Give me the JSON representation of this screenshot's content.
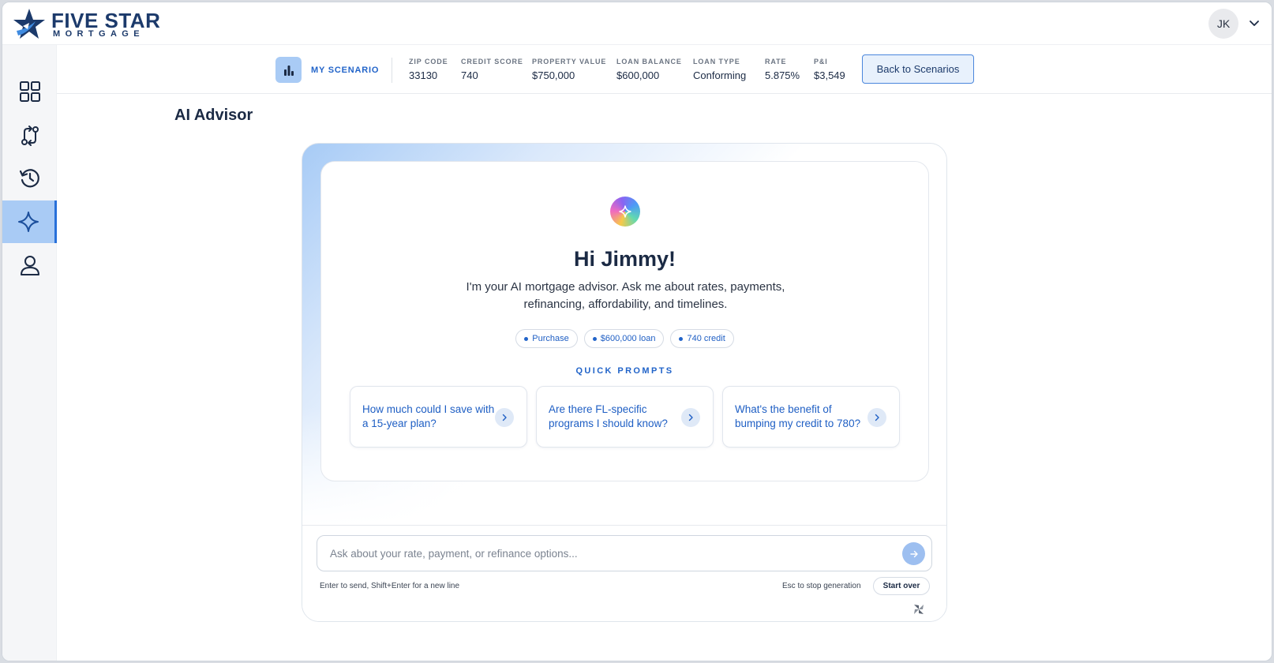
{
  "brand": {
    "name_line1": "FIVE STAR",
    "name_line2": "MORTGAGE",
    "navy": "#1c3a6b",
    "accent": "#2264c9"
  },
  "user": {
    "initials": "JK"
  },
  "sidebar": {
    "items": [
      {
        "name": "dashboard",
        "icon": "grid-icon",
        "active": false
      },
      {
        "name": "compare",
        "icon": "compare-arrows-icon",
        "active": false
      },
      {
        "name": "history",
        "icon": "history-icon",
        "active": false
      },
      {
        "name": "ai-advisor",
        "icon": "sparkle-icon",
        "active": true
      },
      {
        "name": "profile",
        "icon": "user-icon",
        "active": false
      }
    ]
  },
  "scenario": {
    "label": "MY SCENARIO",
    "icon": "bar-chart-icon",
    "stats": [
      {
        "label": "ZIP CODE",
        "value": "33130"
      },
      {
        "label": "CREDIT SCORE",
        "value": "740"
      },
      {
        "label": "PROPERTY VALUE",
        "value": "$750,000"
      },
      {
        "label": "LOAN BALANCE",
        "value": "$600,000"
      },
      {
        "label": "LOAN TYPE",
        "value": "Conforming"
      },
      {
        "label": "RATE",
        "value": "5.875%"
      },
      {
        "label": "P&I",
        "value": "$3,549"
      }
    ],
    "back_button": "Back to Scenarios"
  },
  "page": {
    "title": "AI Advisor"
  },
  "advisor": {
    "greeting": "Hi Jimmy!",
    "intro": "I'm your AI mortgage advisor. Ask me about rates, payments, refinancing, affordability, and timelines.",
    "chips": [
      "Purchase",
      "$600,000 loan",
      "740 credit"
    ],
    "quick_prompts_title": "QUICK PROMPTS",
    "quick_prompts": [
      "How much could I save with a 15-year plan?",
      "Are there FL-specific programs I should know?",
      "What's the benefit of bumping my credit to 780?"
    ],
    "input_placeholder": "Ask about your rate, payment, or refinance options...",
    "input_value": "",
    "hint_left": "Enter to send, Shift+Enter for a new line",
    "hint_right": "Esc to stop generation",
    "start_over": "Start over"
  }
}
